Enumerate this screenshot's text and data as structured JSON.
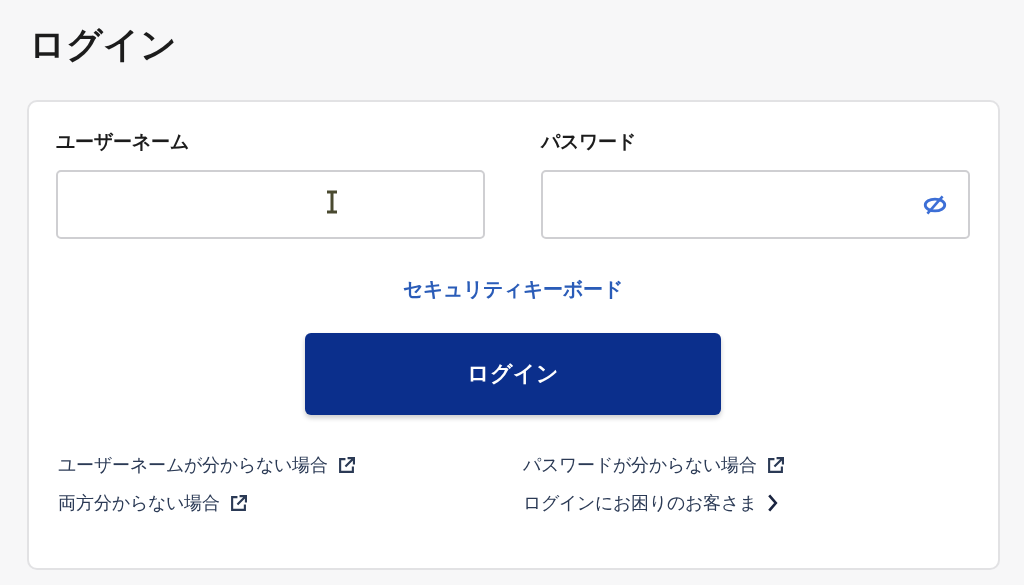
{
  "page_title": "ログイン",
  "fields": [
    {
      "label": "ユーザーネーム",
      "kind": "text"
    },
    {
      "label": "パスワード",
      "kind": "password"
    }
  ],
  "security_keyboard_link": "セキュリティキーボード",
  "login_button": "ログイン",
  "help_links": [
    {
      "text": "ユーザーネームが分からない場合",
      "kind": "external"
    },
    {
      "text": "パスワードが分からない場合",
      "kind": "external"
    },
    {
      "text": "両方分からない場合",
      "kind": "external"
    },
    {
      "text": "ログインにお困りのお客さま",
      "kind": "chevron"
    }
  ]
}
